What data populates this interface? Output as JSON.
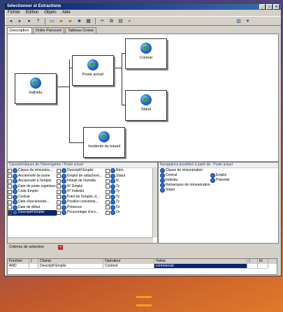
{
  "window": {
    "title": "Sélectionner et Extractions"
  },
  "menu": [
    "Fichier",
    "Édition",
    "Objets",
    "Aide"
  ],
  "tabs": [
    "Description",
    "Ordre Parcourir",
    "Tableau Croisé"
  ],
  "nodes": {
    "individu": "Individu",
    "poste_actuel": "Poste actuel",
    "contrat": "Contrat",
    "statut": "Statut",
    "incidents": "Incidents du travail"
  },
  "left_panel": {
    "header": "Caractéristiques de l'interrogation / Poste actuel",
    "col1": [
      "Classe de rémunéra...",
      "Ancienneté de poste",
      "Ancienneté à l'emploi",
      "Date de poste supérieur...",
      "Code Emploi",
      "Contrat",
      "Date d'ancienneté...",
      "Date de début",
      "Descriptif Emploi"
    ],
    "col2": [
      "Descriptif Emploi",
      "Emploi de rattachem...",
      "Intitulé de l'échelle",
      "N° Emploi",
      "N° Individu",
      "Point de l'emploi, d...",
      "Position conventio...",
      "Présence",
      "Pourcentage d'occ..."
    ],
    "col3": [
      "Rém.",
      "Statut",
      "N.",
      "Ty",
      "Ty",
      "Ty",
      "Ty",
      "Or",
      "Or"
    ]
  },
  "right_panel": {
    "header": "Navigations possibles à partir de : Poste actuel",
    "items": [
      "Classe de rémunération",
      "Contrat",
      "Emploi",
      "Individu",
      "Potentiel",
      "Remarques de rémunération",
      "Statut"
    ]
  },
  "criteria": {
    "title": "Critères de sélection",
    "headers": [
      "Fonction",
      "(",
      "Champ",
      "Opérateur",
      "Valeur",
      ")",
      "Et"
    ],
    "row": [
      "AND",
      "",
      "Descriptif Emploi",
      "Contient",
      "commercial",
      "",
      ""
    ]
  }
}
